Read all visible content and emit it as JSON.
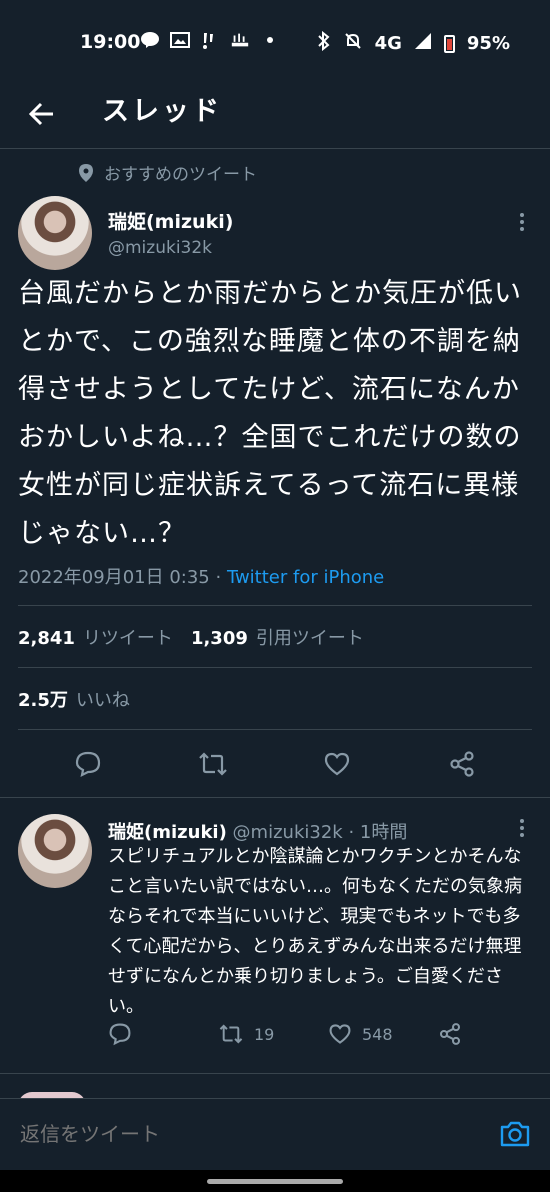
{
  "status_bar": {
    "time": "19:00",
    "icons_left": [
      "line-icon",
      "gallery-icon",
      "sports-icon",
      "cafe-icon",
      "dot-icon"
    ],
    "network": "4G",
    "battery": "95%",
    "icons_right": [
      "bluetooth-icon",
      "mute-icon",
      "signal-icon",
      "battery-icon"
    ]
  },
  "header": {
    "title": "スレッド",
    "back_icon": "arrow-left-icon"
  },
  "recommended": {
    "label": "おすすめのツイート",
    "icon": "location-pin-icon"
  },
  "main_tweet": {
    "name": "瑞姫(mizuki)",
    "handle": "@mizuki32k",
    "text": "台風だからとか雨だからとか気圧が低いとかで、この強烈な睡魔と体の不調を納得させようとしてたけど、流石になんかおかしいよね…？全国でこれだけの数の女性が同じ症状訴えてるって流石に異様じゃない…？",
    "date": "2022年09月01日 0:35",
    "separator": " · ",
    "source": "Twitter for iPhone",
    "retweets": "2,841",
    "retweets_label": "リツイート",
    "quotes": "1,309",
    "quotes_label": "引用ツイート",
    "likes": "2.5万",
    "likes_label": "いいね"
  },
  "reply": {
    "name": "瑞姫(mizuki)",
    "handle": "@mizuki32k",
    "time": "· 1時間",
    "text": "スピリチュアルとか陰謀論とかワクチンとかそんなこと言いたい訳ではない…。何もなくただの気象病ならそれで本当にいいけど、現実でもネットでも多くて心配だから、とりあえずみんな出来るだけ無理せずになんとか乗り切りましょう。ご自愛ください。",
    "retweets": "19",
    "likes": "548"
  },
  "compose": {
    "placeholder": "返信をツイート"
  },
  "colors": {
    "background": "#15202b",
    "accent": "#1d9bf0",
    "muted": "#8899a6",
    "divider": "#38444d"
  }
}
